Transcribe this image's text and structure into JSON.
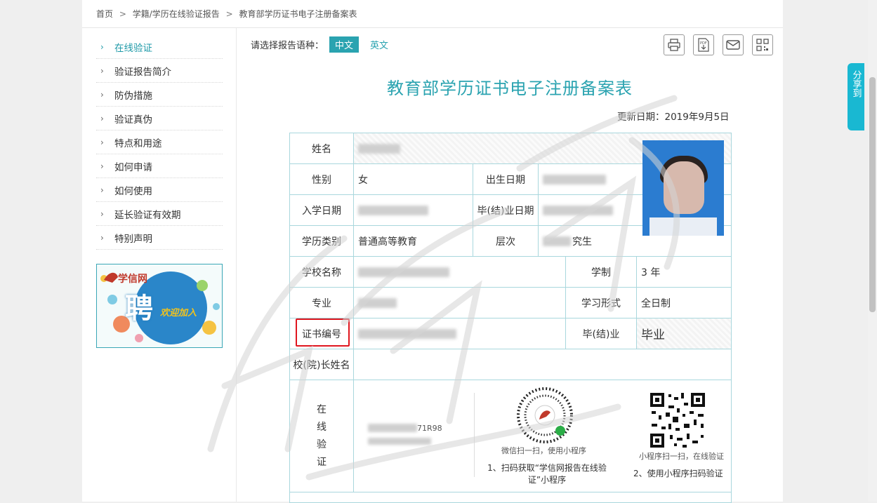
{
  "breadcrumb": [
    "首页",
    ">",
    "学籍/学历在线验证报告",
    ">",
    "教育部学历证书电子注册备案表"
  ],
  "sidebar": {
    "items": [
      {
        "label": "在线验证",
        "active": true
      },
      {
        "label": "验证报告简介"
      },
      {
        "label": "防伪措施"
      },
      {
        "label": "验证真伪"
      },
      {
        "label": "特点和用途"
      },
      {
        "label": "如何申请"
      },
      {
        "label": "如何使用"
      },
      {
        "label": "延长验证有效期"
      },
      {
        "label": "特别声明"
      }
    ],
    "banner": {
      "logo": "学信网",
      "big": "聘",
      "small": "欢迎加入"
    }
  },
  "language": {
    "prompt": "请选择报告语种：",
    "cn": "中文",
    "en": "英文"
  },
  "tools": [
    "print-icon",
    "pdf-download-icon",
    "mail-icon",
    "qrcode-icon"
  ],
  "report": {
    "title": "教育部学历证书电子注册备案表",
    "update_date": "更新日期：2019年9月5日",
    "labels": {
      "name": "姓名",
      "gender": "性别",
      "birth": "出生日期",
      "enroll": "入学日期",
      "grad_date": "毕(结)业日期",
      "edu_type": "学历类别",
      "level": "层次",
      "school": "学校名称",
      "duration": "学制",
      "major": "专业",
      "study_form": "学习形式",
      "cert_no": "证书编号",
      "grad_status": "毕(结)业",
      "president": "校(院)长姓名",
      "online_verify": [
        "在",
        "线",
        "验",
        "证"
      ]
    },
    "values": {
      "gender": "女",
      "edu_type": "普通高等教育",
      "level": "究生",
      "duration": "3 年",
      "study_form": "全日制",
      "grad_status": "毕业"
    },
    "verify": {
      "code_partial": "71R98",
      "wechat_caption": "微信扫一扫，使用小程序",
      "step1": "1、扫码获取“学信网报告在线验证”小程序",
      "mini_caption": "小程序扫一扫，在线验证",
      "step2": "2、使用小程序扫码验证"
    }
  },
  "share": {
    "label": "分享到"
  },
  "colors": {
    "accent": "#2aa3b0",
    "share": "#19b8d2",
    "highlight": "#e0161f"
  }
}
